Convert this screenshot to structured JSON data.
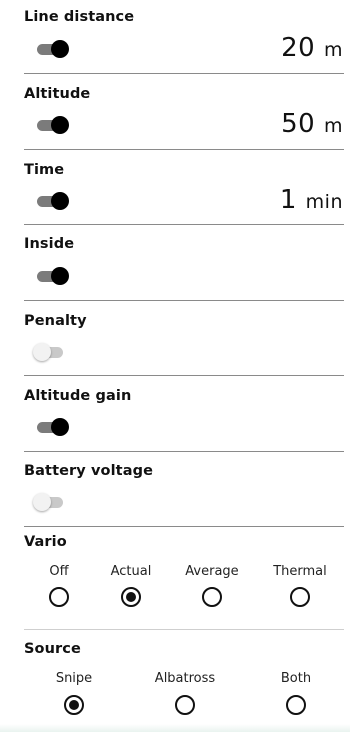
{
  "settings": [
    {
      "title": "Line distance",
      "enabled": true,
      "value": "20",
      "unit": "m"
    },
    {
      "title": "Altitude",
      "enabled": true,
      "value": "50",
      "unit": "m"
    },
    {
      "title": "Time",
      "enabled": true,
      "value": "1",
      "unit": "min"
    },
    {
      "title": "Inside",
      "enabled": true
    },
    {
      "title": "Penalty",
      "enabled": false
    },
    {
      "title": "Altitude gain",
      "enabled": true
    },
    {
      "title": "Battery voltage",
      "enabled": false
    }
  ],
  "vario": {
    "title": "Vario",
    "options": [
      "Off",
      "Actual",
      "Average",
      "Thermal"
    ],
    "selected": "Actual"
  },
  "source": {
    "title": "Source",
    "options": [
      "Snipe",
      "Albatross",
      "Both"
    ],
    "selected": "Snipe"
  },
  "colors": {
    "switch_on_thumb": "#000000",
    "switch_on_track": "#7b7b7b",
    "switch_off_thumb": "#f2f2f2",
    "switch_off_track": "#c9c9c9",
    "divider": "#8a8a8a"
  }
}
